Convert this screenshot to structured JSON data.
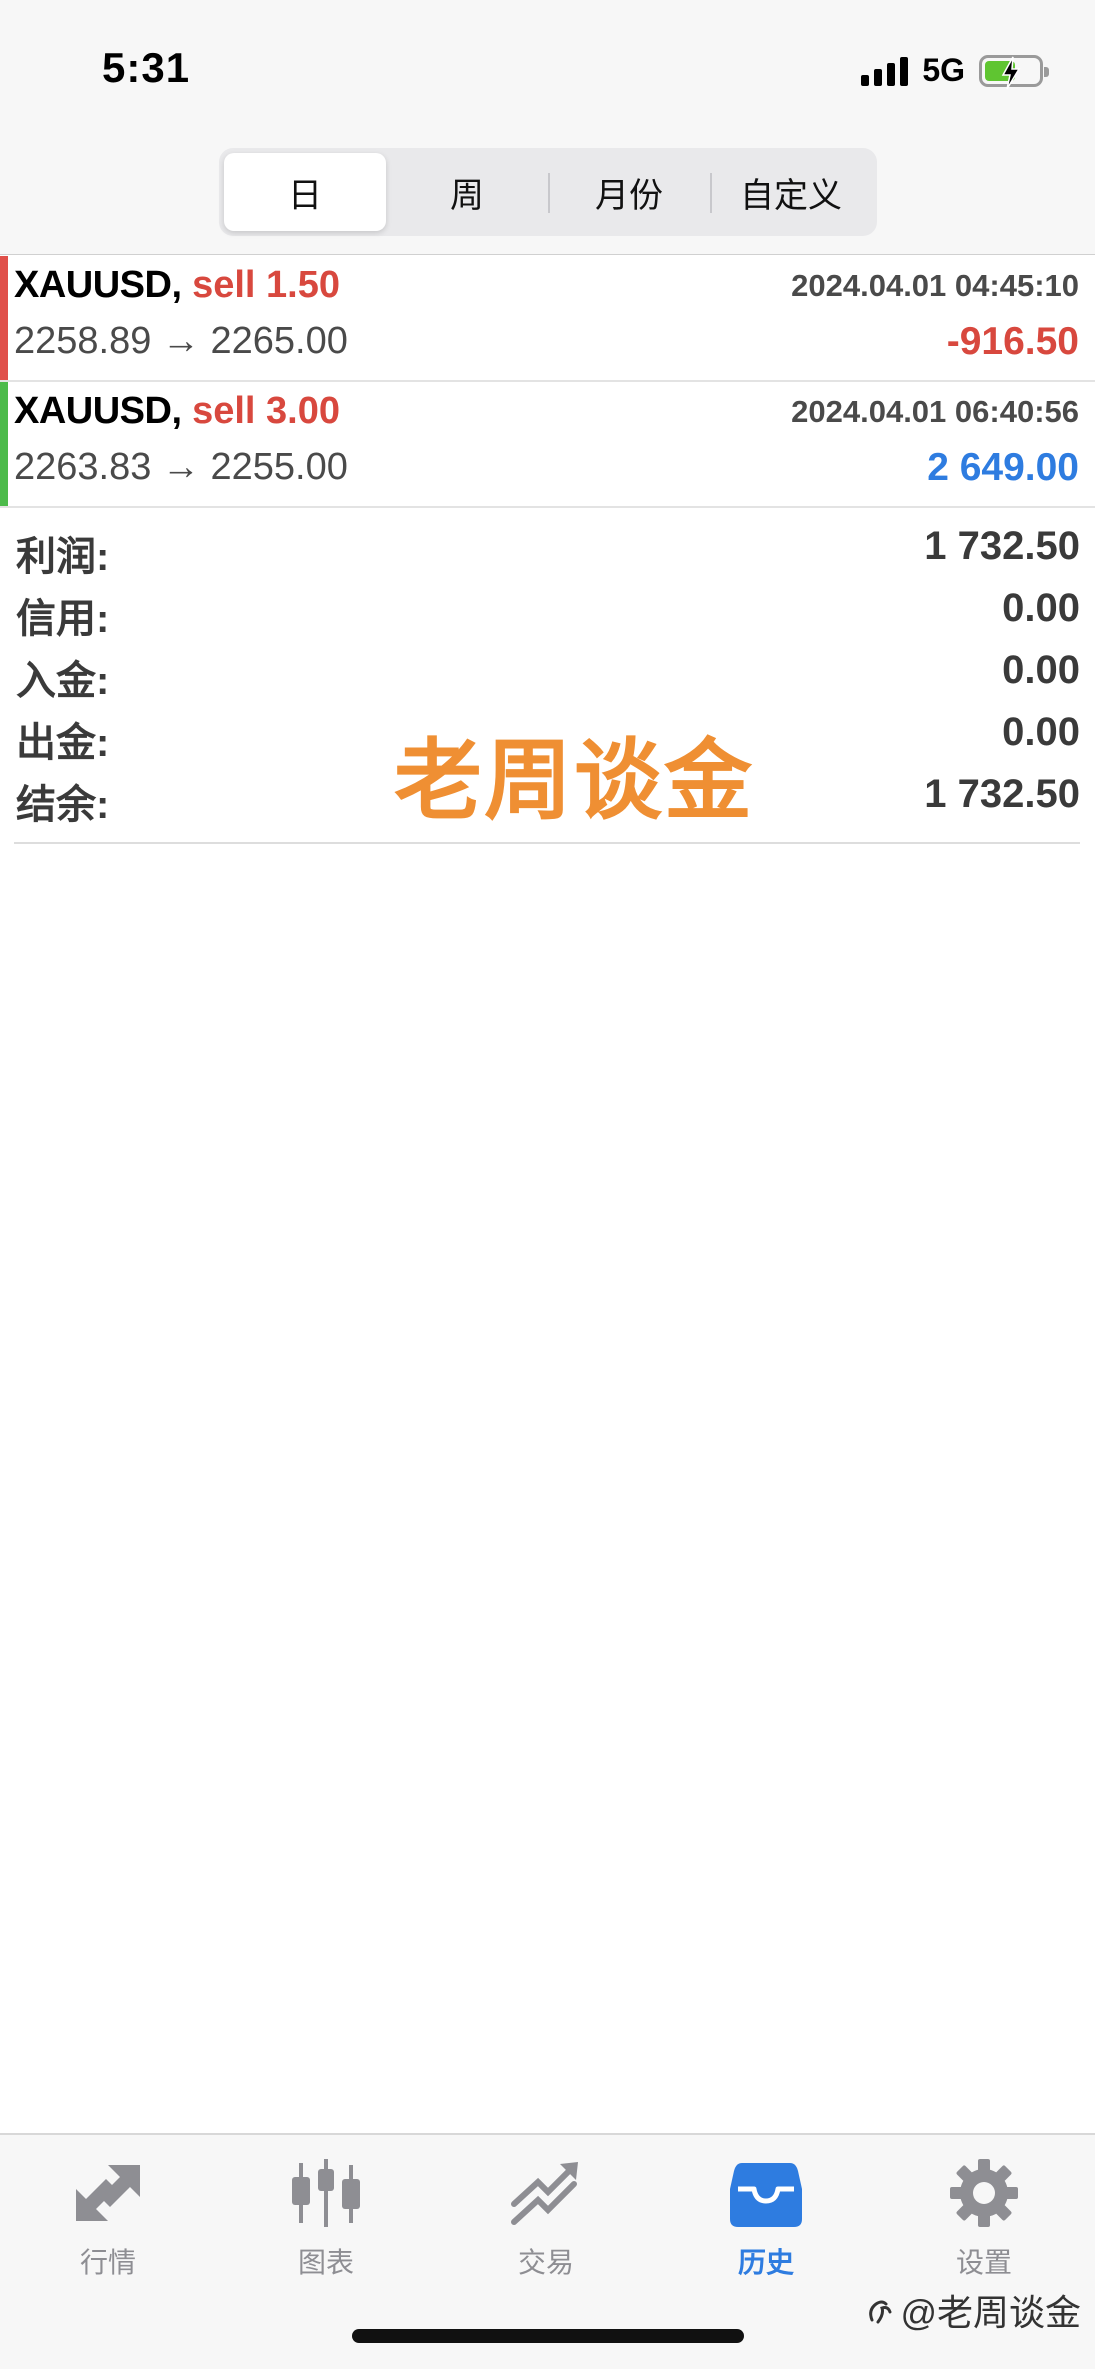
{
  "status_bar": {
    "time": "5:31",
    "network": "5G"
  },
  "segments": [
    {
      "label": "日",
      "active": true
    },
    {
      "label": "周",
      "active": false
    },
    {
      "label": "月份",
      "active": false
    },
    {
      "label": "自定义",
      "active": false
    }
  ],
  "trades": [
    {
      "symbol": "XAUUSD,",
      "side": "sell 1.50",
      "time": "2024.04.01 04:45:10",
      "prices": "2258.89 → 2265.00",
      "profit": "-916.50",
      "bar_color": "#e0504a",
      "profit_color": "#d8483e"
    },
    {
      "symbol": "XAUUSD,",
      "side": "sell 3.00",
      "time": "2024.04.01 06:40:56",
      "prices": "2263.83 → 2255.00",
      "profit": "2 649.00",
      "bar_color": "#4cbb4a",
      "profit_color": "#2e7ce0"
    }
  ],
  "summary": [
    {
      "label": "利润:",
      "value": "1 732.50"
    },
    {
      "label": "信用:",
      "value": "0.00"
    },
    {
      "label": "入金:",
      "value": "0.00"
    },
    {
      "label": "出金:",
      "value": "0.00"
    },
    {
      "label": "结余:",
      "value": "1 732.50"
    }
  ],
  "watermark": "老周谈金",
  "tabbar": [
    {
      "label": "行情",
      "icon": "quotes-icon",
      "active": false
    },
    {
      "label": "图表",
      "icon": "chart-icon",
      "active": false
    },
    {
      "label": "交易",
      "icon": "trade-icon",
      "active": false
    },
    {
      "label": "历史",
      "icon": "history-icon",
      "active": true
    },
    {
      "label": "设置",
      "icon": "settings-icon",
      "active": false
    }
  ],
  "credit": "@老周谈金",
  "colors": {
    "accent": "#2e7ce0",
    "loss": "#d8483e",
    "watermark": "#ef8f33"
  }
}
